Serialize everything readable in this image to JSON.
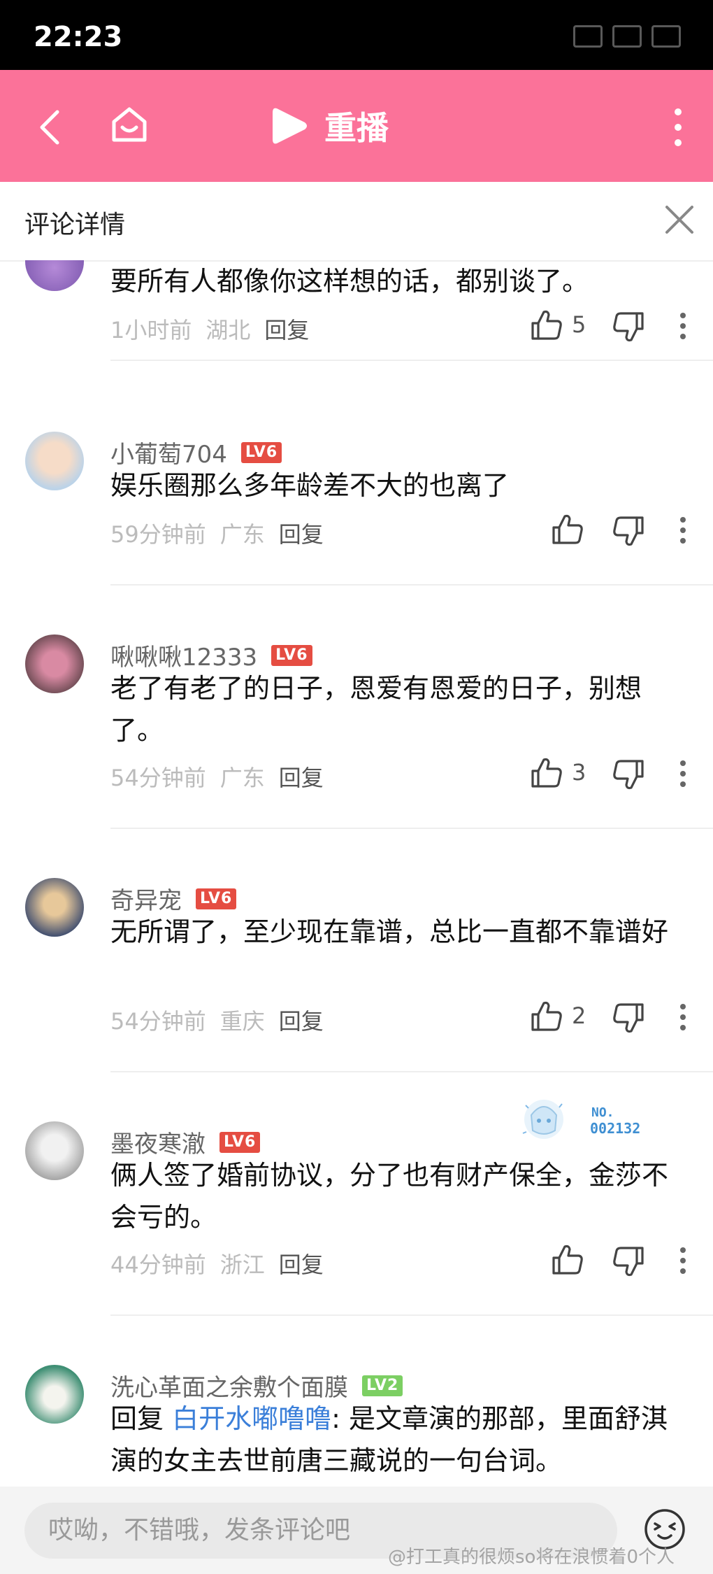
{
  "status_bar": {
    "time": "22:23"
  },
  "app_bar": {
    "replay_label": "重播"
  },
  "detail_bar": {
    "title": "评论详情"
  },
  "comments": [
    {
      "username": "",
      "level": "",
      "text": "要所有人都像你这样想的话，都别谈了。",
      "time": "1小时前",
      "location": "湖北",
      "reply_label": "回复",
      "likes": "5"
    },
    {
      "username": "小葡萄704",
      "level": "LV6",
      "text": "娱乐圈那么多年龄差不大的也离了",
      "time": "59分钟前",
      "location": "广东",
      "reply_label": "回复",
      "likes": ""
    },
    {
      "username": "啾啾啾12333",
      "level": "LV6",
      "text": "老了有老了的日子，恩爱有恩爱的日子，别想了。",
      "time": "54分钟前",
      "location": "广东",
      "reply_label": "回复",
      "likes": "3"
    },
    {
      "username": "奇异宠",
      "level": "LV6",
      "text": "无所谓了，至少现在靠谱，总比一直都不靠谱好",
      "time": "54分钟前",
      "location": "重庆",
      "reply_label": "回复",
      "likes": "2"
    },
    {
      "username": "墨夜寒澈",
      "level": "LV6",
      "text": "俩人签了婚前协议，分了也有财产保全，金莎不会亏的。",
      "time": "44分钟前",
      "location": "浙江",
      "reply_label": "回复",
      "likes": ""
    },
    {
      "username": "洗心革面之余敷个面膜",
      "level": "LV2",
      "reply_prefix": "回复",
      "mention": "白开水嘟噜噜",
      "text": ": 是文章演的那部，里面舒淇演的女主去世前唐三藏说的一句台词。"
    }
  ],
  "sticker": {
    "number_line1": "NO.",
    "number_line2": "002132"
  },
  "input_bar": {
    "placeholder": "哎呦，不错哦，发条评论吧"
  },
  "watermark": "@打工真的很烦so将在浪惯着0个人",
  "colors": {
    "brand_pink": "#fb7299",
    "level_red": "#e54d42",
    "level_green": "#7ccf63",
    "mention_blue": "#3b7fd9"
  }
}
